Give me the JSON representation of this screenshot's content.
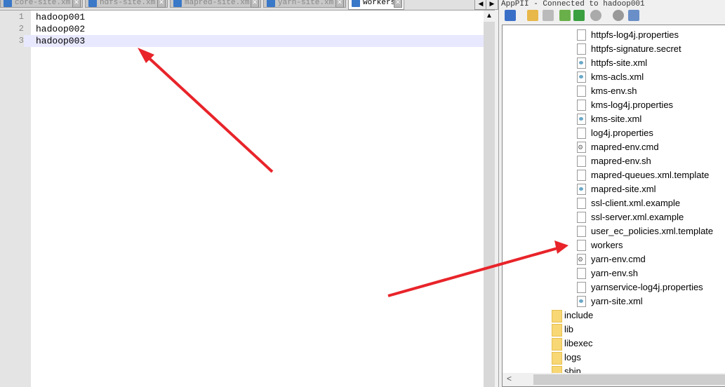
{
  "editor": {
    "tabs": [
      {
        "label": "core-site.xml",
        "active": false
      },
      {
        "label": "hdfs-site.xml",
        "active": false
      },
      {
        "label": "mapred-site.xml",
        "active": false
      },
      {
        "label": "yarn-site.xml",
        "active": false
      },
      {
        "label": "workers",
        "active": true
      }
    ],
    "lines": [
      {
        "num": "1",
        "text": "hadoop001"
      },
      {
        "num": "2",
        "text": "hadoop002"
      },
      {
        "num": "3",
        "text": "hadoop003"
      }
    ],
    "current_line": 3
  },
  "panel": {
    "title": "AppPII - Connected to hadoop001",
    "toolbar": [
      "connect-icon",
      "folder-open-icon",
      "download-icon",
      "upload-icon",
      "refresh-icon",
      "stop-icon",
      "settings-icon",
      "list-view-icon"
    ],
    "files": [
      {
        "name": "httpfs-log4j.properties",
        "type": "file"
      },
      {
        "name": "httpfs-signature.secret",
        "type": "file"
      },
      {
        "name": "httpfs-site.xml",
        "type": "xml"
      },
      {
        "name": "kms-acls.xml",
        "type": "xml"
      },
      {
        "name": "kms-env.sh",
        "type": "file"
      },
      {
        "name": "kms-log4j.properties",
        "type": "file"
      },
      {
        "name": "kms-site.xml",
        "type": "xml"
      },
      {
        "name": "log4j.properties",
        "type": "file"
      },
      {
        "name": "mapred-env.cmd",
        "type": "cmd"
      },
      {
        "name": "mapred-env.sh",
        "type": "file"
      },
      {
        "name": "mapred-queues.xml.template",
        "type": "file"
      },
      {
        "name": "mapred-site.xml",
        "type": "xml"
      },
      {
        "name": "ssl-client.xml.example",
        "type": "file"
      },
      {
        "name": "ssl-server.xml.example",
        "type": "file"
      },
      {
        "name": "user_ec_policies.xml.template",
        "type": "file"
      },
      {
        "name": "workers",
        "type": "file"
      },
      {
        "name": "yarn-env.cmd",
        "type": "cmd"
      },
      {
        "name": "yarn-env.sh",
        "type": "file"
      },
      {
        "name": "yarnservice-log4j.properties",
        "type": "file"
      },
      {
        "name": "yarn-site.xml",
        "type": "xml"
      }
    ],
    "folders": [
      "include",
      "lib",
      "libexec",
      "logs",
      "sbin"
    ]
  },
  "annotation_color": "#e8242a"
}
